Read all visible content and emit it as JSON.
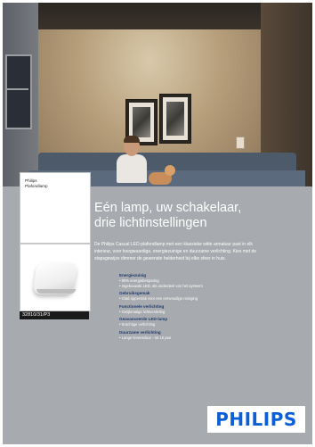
{
  "brand": {
    "name": "Philips",
    "product_type": "Plafondlamp",
    "product_code": "32810/31/P3",
    "logo_text": "PHILIPS",
    "colors": {
      "logo_blue": "#0b5ed7",
      "feature_title": "#1e3a6e",
      "panel_grey": "#a7aaae"
    }
  },
  "headline": {
    "line1": "Eén lamp, uw schakelaar,",
    "line2": "drie lichtinstellingen"
  },
  "intro": {
    "line1": "De Philips Casual LED-plafondlamp met een klassieke witte armatuur past in elk",
    "line2": "interieur, voor hoogwaardige, energiezuinige en duurzame verlichting. Kies met de",
    "line3": "stapsgewijze dimmer de gewenste helderheid bij elke sfeer in huis."
  },
  "features": [
    {
      "title": "Energiezuinig",
      "items": [
        "80% energiebesparing",
        "Ingebouwde LED, als onderdeel van het systeem"
      ]
    },
    {
      "title": "Gebruiksgemak",
      "items": [
        "Glad oppervlak voor een eenvoudige reiniging"
      ]
    },
    {
      "title": "Functionele verlichting",
      "items": [
        "Gelijkmatige lichtverdeling"
      ]
    },
    {
      "title": "Geavanceerde LED-lamp",
      "items": [
        "Krachtige verlichting"
      ]
    },
    {
      "title": "Duurzame verlichting",
      "items": [
        "Lange levensduur - tot 15 jaar"
      ]
    }
  ]
}
